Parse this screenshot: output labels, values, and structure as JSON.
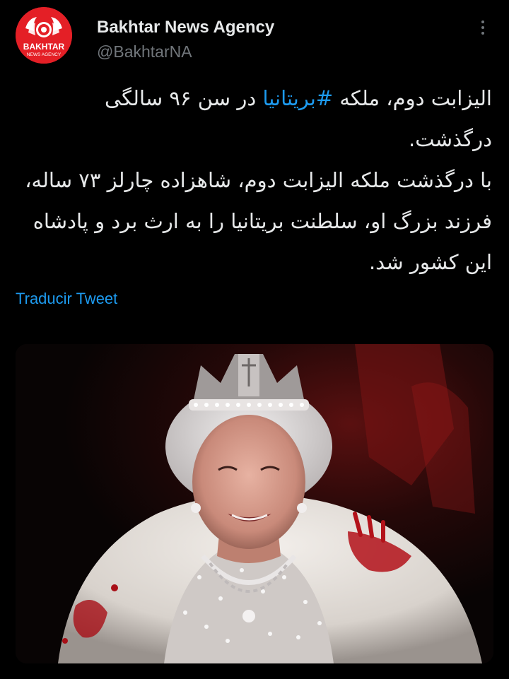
{
  "author": {
    "display_name": "Bakhtar News Agency",
    "handle": "@BakhtarNA",
    "logo_text_line1": "BAKHTAR",
    "logo_text_line2": "NEWS AGENCY",
    "brand_color": "#e41f26"
  },
  "tweet": {
    "paragraph1_before_hashtag": "الیزابت دوم، ملکه ",
    "hashtag": "#بریتانیا",
    "paragraph1_after_hashtag": " در سن ۹۶ سالگی درگذشت.",
    "paragraph2": "با درگذشت ملکه الیزابت دوم، شاهزاده چارلز ۷۳ ساله، فرزند بزرگ او، سلطنت بریتانیا را به ارث برد و پادشاه این کشور شد."
  },
  "actions": {
    "translate_label": "Traducir Tweet",
    "more_icon": "more-horizontal-icon"
  },
  "colors": {
    "background": "#000000",
    "text": "#e7e9ea",
    "secondary_text": "#71767b",
    "link": "#1d9bf0"
  }
}
